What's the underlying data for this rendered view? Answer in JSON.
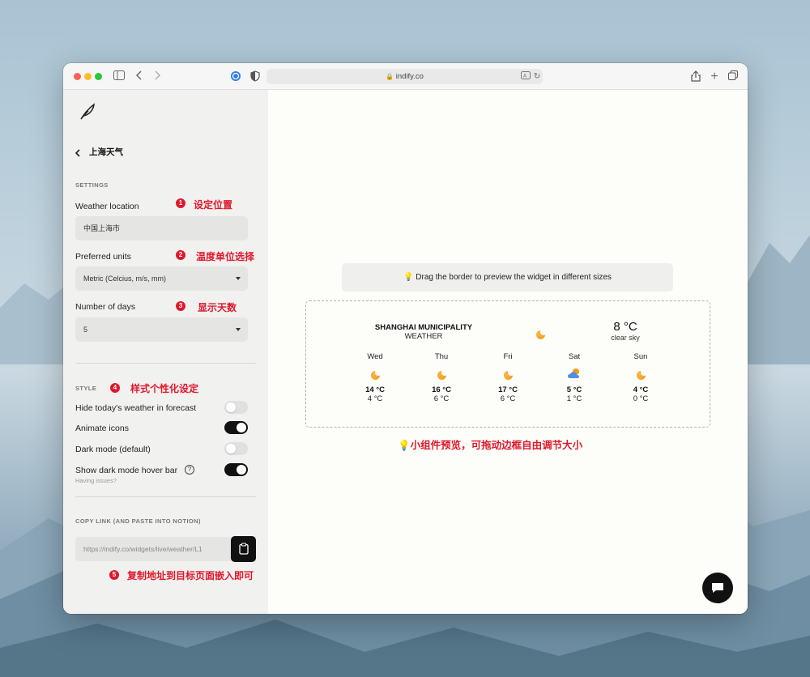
{
  "browser": {
    "url": "indify.co"
  },
  "sidebar": {
    "back_title": "上海天气",
    "settings_section": "SETTINGS",
    "location_label": "Weather location",
    "location_value": "中国上海市",
    "units_label": "Preferred units",
    "units_value": "Metric (Celcius, m/s, mm)",
    "days_label": "Number of days",
    "days_value": "5",
    "style_section": "STYLE",
    "toggles": [
      {
        "label": "Hide today's weather in forecast",
        "on": false
      },
      {
        "label": "Animate icons",
        "on": true
      },
      {
        "label": "Dark mode (default)",
        "on": false
      },
      {
        "label": "Show dark mode hover bar",
        "on": true
      }
    ],
    "help_glyph": "?",
    "having_issues": "Having issues?",
    "copy_section": "COPY LINK (AND PASTE INTO NOTION)",
    "copy_value": "https://indify.co/widgets/live/weather/L1"
  },
  "annotations": [
    {
      "num": "1",
      "text": "设定位置"
    },
    {
      "num": "2",
      "text": "温度单位选择"
    },
    {
      "num": "3",
      "text": "显示天数"
    },
    {
      "num": "4",
      "text": "样式个性化设定"
    },
    {
      "num": "5",
      "text": "复制地址到目标页面嵌入即可"
    }
  ],
  "preview": {
    "hint": "Drag the border to preview the widget in different sizes",
    "bottom_note": "💡小组件预览，可拖动边框自由调节大小"
  },
  "widget": {
    "location_line1": "SHANGHAI MUNICIPALITY",
    "location_line2": "WEATHER",
    "current_temp": "8 °C",
    "current_desc": "clear sky",
    "days": [
      {
        "name": "Wed",
        "icon": "sun-icon",
        "hi": "14 °C",
        "lo": "4 °C"
      },
      {
        "name": "Thu",
        "icon": "sun-icon",
        "hi": "16 °C",
        "lo": "6 °C"
      },
      {
        "name": "Fri",
        "icon": "sun-icon",
        "hi": "17 °C",
        "lo": "6 °C"
      },
      {
        "name": "Sat",
        "icon": "cloud-sun-icon",
        "hi": "5 °C",
        "lo": "1 °C"
      },
      {
        "name": "Sun",
        "icon": "sun-icon",
        "hi": "4 °C",
        "lo": "0 °C"
      }
    ]
  },
  "colors": {
    "annotation_red": "#e0182b",
    "sidebar_bg": "#f1f1f0",
    "toggle_on": "#111111"
  }
}
